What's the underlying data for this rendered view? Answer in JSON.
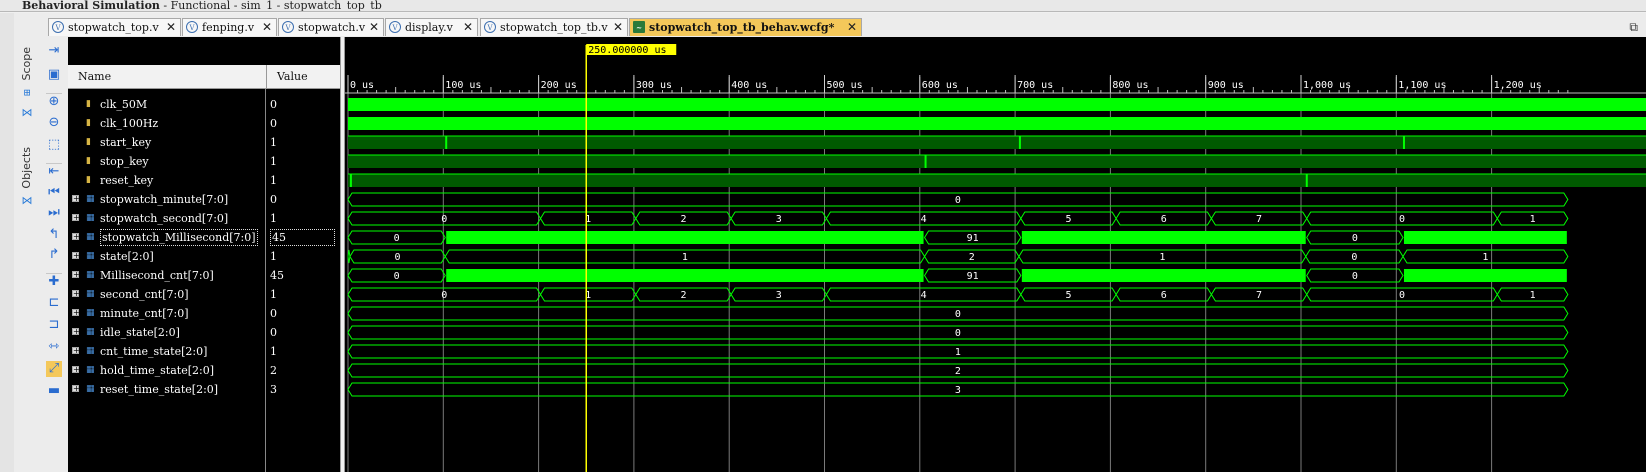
{
  "window": {
    "title_bold": "Behavioral Simulation",
    "title_rest": " - Functional - sim_1 - stopwatch_top_tb"
  },
  "side_tabs": {
    "scope": "Scope",
    "objects": "Objects"
  },
  "tabs": [
    {
      "label": "stopwatch_top.v",
      "active": false
    },
    {
      "label": "fenping.v",
      "active": false
    },
    {
      "label": "stopwatch.v",
      "active": false
    },
    {
      "label": "display.v",
      "active": false
    },
    {
      "label": "stopwatch_top_tb.v",
      "active": false
    },
    {
      "label": "stopwatch_top_tb_behav.wcfg*",
      "active": true
    }
  ],
  "headers": {
    "name": "Name",
    "value": "Value"
  },
  "cursor": {
    "label": "250.000000 us",
    "time_us": 250
  },
  "timeline": {
    "range_us": [
      0,
      1280
    ],
    "tick_labels": [
      "0 us",
      "100 us",
      "200 us",
      "300 us",
      "400 us",
      "500 us",
      "600 us",
      "700 us",
      "800 us",
      "900 us",
      "1,000 us",
      "1,100 us",
      "1,200 us"
    ],
    "tick_values": [
      0,
      100,
      200,
      300,
      400,
      500,
      600,
      700,
      800,
      900,
      1000,
      1100,
      1200
    ]
  },
  "colors": {
    "wave": "#00ff00",
    "wave_dark": "#005a00",
    "cursor": "#ffff00",
    "grid": "#7a7a7a"
  },
  "signals": [
    {
      "name": "clk_50M",
      "value": "0",
      "kind": "clock",
      "expandable": false
    },
    {
      "name": "clk_100Hz",
      "value": "0",
      "kind": "clock",
      "expandable": false
    },
    {
      "name": "start_key",
      "value": "1",
      "kind": "bit",
      "pulses": [
        102,
        704,
        1107
      ],
      "expandable": false
    },
    {
      "name": "stop_key",
      "value": "1",
      "kind": "bit",
      "pulses": [
        605
      ],
      "expandable": false
    },
    {
      "name": "reset_key",
      "value": "1",
      "kind": "bit",
      "pulses": [
        2,
        1005
      ],
      "expandable": false
    },
    {
      "name": "stopwatch_minute[7:0]",
      "value": "0",
      "kind": "bus",
      "expandable": true,
      "segments": [
        {
          "start": 0,
          "end": 1280,
          "label": "0"
        }
      ]
    },
    {
      "name": "stopwatch_second[7:0]",
      "value": "1",
      "kind": "bus",
      "expandable": true,
      "segments": [
        {
          "start": 0,
          "end": 202,
          "label": "0"
        },
        {
          "start": 202,
          "end": 302,
          "label": "1"
        },
        {
          "start": 302,
          "end": 402,
          "label": "2"
        },
        {
          "start": 402,
          "end": 502,
          "label": "3"
        },
        {
          "start": 502,
          "end": 706,
          "label": "4"
        },
        {
          "start": 706,
          "end": 806,
          "label": "5"
        },
        {
          "start": 806,
          "end": 906,
          "label": "6"
        },
        {
          "start": 906,
          "end": 1006,
          "label": "7"
        },
        {
          "start": 1006,
          "end": 1206,
          "label": "0"
        },
        {
          "start": 1206,
          "end": 1280,
          "label": "1"
        }
      ]
    },
    {
      "name": "stopwatch_Millisecond[7:0]",
      "value": "45",
      "kind": "bus",
      "expandable": true,
      "selected": true,
      "segments": [
        {
          "start": 0,
          "end": 102,
          "label": "0"
        },
        {
          "start": 102,
          "end": 605,
          "label": "",
          "dense": true
        },
        {
          "start": 605,
          "end": 706,
          "label": "91"
        },
        {
          "start": 706,
          "end": 1006,
          "label": "",
          "dense": true
        },
        {
          "start": 1006,
          "end": 1107,
          "label": "0"
        },
        {
          "start": 1107,
          "end": 1280,
          "label": "",
          "dense": true
        }
      ]
    },
    {
      "name": "state[2:0]",
      "value": "1",
      "kind": "bus",
      "expandable": true,
      "segments": [
        {
          "start": 0,
          "end": 2,
          "label": ""
        },
        {
          "start": 2,
          "end": 102,
          "label": "0"
        },
        {
          "start": 102,
          "end": 605,
          "label": "1"
        },
        {
          "start": 605,
          "end": 704,
          "label": "2"
        },
        {
          "start": 704,
          "end": 1005,
          "label": "1"
        },
        {
          "start": 1005,
          "end": 1107,
          "label": "0"
        },
        {
          "start": 1107,
          "end": 1280,
          "label": "1"
        }
      ]
    },
    {
      "name": "Millisecond_cnt[7:0]",
      "value": "45",
      "kind": "bus",
      "expandable": true,
      "segments": [
        {
          "start": 0,
          "end": 102,
          "label": "0"
        },
        {
          "start": 102,
          "end": 605,
          "label": "",
          "dense": true
        },
        {
          "start": 605,
          "end": 706,
          "label": "91"
        },
        {
          "start": 706,
          "end": 1006,
          "label": "",
          "dense": true
        },
        {
          "start": 1006,
          "end": 1107,
          "label": "0"
        },
        {
          "start": 1107,
          "end": 1280,
          "label": "",
          "dense": true
        }
      ]
    },
    {
      "name": "second_cnt[7:0]",
      "value": "1",
      "kind": "bus",
      "expandable": true,
      "segments": [
        {
          "start": 0,
          "end": 202,
          "label": "0"
        },
        {
          "start": 202,
          "end": 302,
          "label": "1"
        },
        {
          "start": 302,
          "end": 402,
          "label": "2"
        },
        {
          "start": 402,
          "end": 502,
          "label": "3"
        },
        {
          "start": 502,
          "end": 706,
          "label": "4"
        },
        {
          "start": 706,
          "end": 806,
          "label": "5"
        },
        {
          "start": 806,
          "end": 906,
          "label": "6"
        },
        {
          "start": 906,
          "end": 1006,
          "label": "7"
        },
        {
          "start": 1006,
          "end": 1206,
          "label": "0"
        },
        {
          "start": 1206,
          "end": 1280,
          "label": "1"
        }
      ]
    },
    {
      "name": "minute_cnt[7:0]",
      "value": "0",
      "kind": "bus",
      "expandable": true,
      "segments": [
        {
          "start": 0,
          "end": 1280,
          "label": "0"
        }
      ]
    },
    {
      "name": "idle_state[2:0]",
      "value": "0",
      "kind": "bus",
      "expandable": true,
      "segments": [
        {
          "start": 0,
          "end": 1280,
          "label": "0"
        }
      ]
    },
    {
      "name": "cnt_time_state[2:0]",
      "value": "1",
      "kind": "bus",
      "expandable": true,
      "segments": [
        {
          "start": 0,
          "end": 1280,
          "label": "1"
        }
      ]
    },
    {
      "name": "hold_time_state[2:0]",
      "value": "2",
      "kind": "bus",
      "expandable": true,
      "segments": [
        {
          "start": 0,
          "end": 1280,
          "label": "2"
        }
      ]
    },
    {
      "name": "reset_time_state[2:0]",
      "value": "3",
      "kind": "bus",
      "expandable": true,
      "segments": [
        {
          "start": 0,
          "end": 1280,
          "label": "3"
        }
      ]
    }
  ]
}
